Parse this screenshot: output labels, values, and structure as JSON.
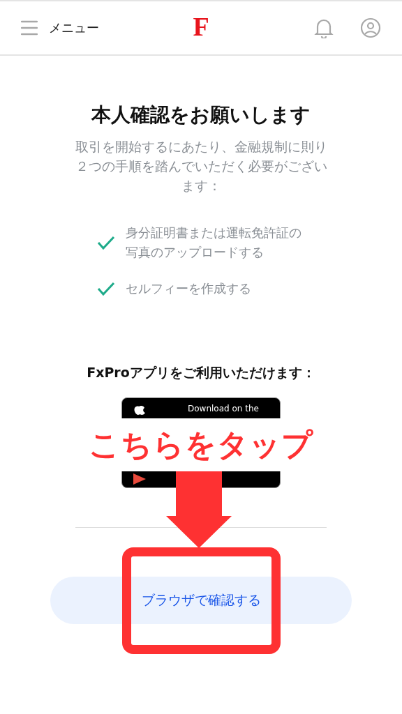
{
  "header": {
    "menu_label": "メニュー",
    "logo": "F"
  },
  "title": "本人確認をお願いします",
  "description": "取引を開始するにあたり、金融規制に則り２つの手順を踏んでいただく必要がございます：",
  "steps": [
    {
      "label": "身分証明書または運転免許証の写真のアップロードする",
      "checked": true
    },
    {
      "label": "セルフィーを作成する",
      "checked": true
    }
  ],
  "app_prompt": "FxProアプリをご利用いただけます：",
  "store_badges": [
    {
      "kind": "apple",
      "caption": "Download on the"
    },
    {
      "kind": "google"
    }
  ],
  "browser_button": "ブラウザで確認する",
  "annotation": {
    "text": "こちらをタップ"
  }
}
